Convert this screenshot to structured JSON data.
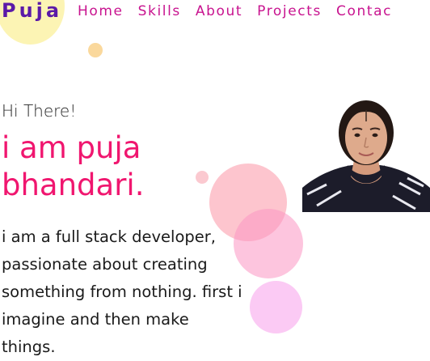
{
  "header": {
    "logo_text": "Puja",
    "nav": [
      {
        "label": "Home"
      },
      {
        "label": "Skills"
      },
      {
        "label": "About"
      },
      {
        "label": "Projects"
      },
      {
        "label": "Contac"
      }
    ]
  },
  "hero": {
    "greeting": "Hi There!",
    "name_line": "i am puja bhandari.",
    "bio": "i am a full stack developer, passionate about creating something from nothing. first i imagine and then make things.",
    "photo_alt": "portrait of puja bhandari"
  },
  "colors": {
    "logo": "#5b1aa8",
    "nav": "#c8138f",
    "accent": "#f0166f",
    "text": "#1a1a1a"
  }
}
